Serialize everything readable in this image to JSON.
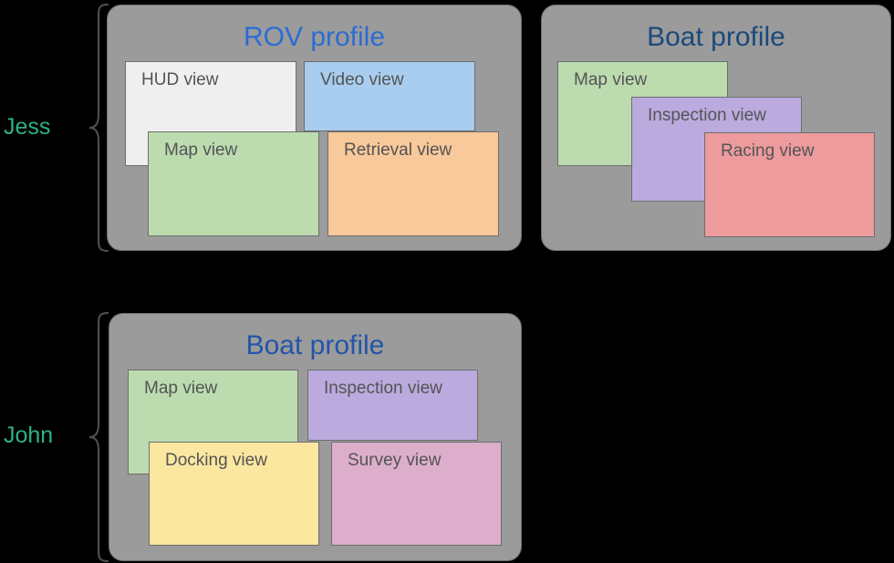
{
  "colors": {
    "background": "#000000",
    "panel_fill": "#9b9b9b",
    "panel_stroke": "#6e6e6e",
    "user_label": "#2eb086",
    "view_label_text": "#545454",
    "view_stroke": "#6e6e6e",
    "title_blue_bright": "#2b6cd4",
    "title_blue_medium": "#2255aa",
    "title_blue_dark": "#1a4a7a",
    "view_hud": "#efefef",
    "view_video": "#a8cdee",
    "view_map": "#bcdcb0",
    "view_retrieval": "#f8c99a",
    "view_inspection": "#bbaade",
    "view_racing": "#ed9b9d",
    "view_docking": "#fce7a0",
    "view_survey": "#ddaecb"
  },
  "users": [
    {
      "name": "Jess",
      "id": "jess"
    },
    {
      "name": "John",
      "id": "john"
    }
  ],
  "profiles": [
    {
      "id": "jess-rov",
      "title": "ROV profile",
      "title_color": "#2b6cd4",
      "owner": "Jess",
      "views": [
        {
          "label": "HUD view",
          "color": "#efefef"
        },
        {
          "label": "Video view",
          "color": "#a8cdee"
        },
        {
          "label": "Map view",
          "color": "#bcdcb0"
        },
        {
          "label": "Retrieval view",
          "color": "#f8c99a"
        }
      ]
    },
    {
      "id": "jess-boat",
      "title": "Boat profile",
      "title_color": "#1a4a7a",
      "owner": "Jess",
      "views": [
        {
          "label": "Map view",
          "color": "#bcdcb0"
        },
        {
          "label": "Inspection view",
          "color": "#bbaade"
        },
        {
          "label": "Racing view",
          "color": "#ed9b9d"
        }
      ]
    },
    {
      "id": "john-boat",
      "title": "Boat profile",
      "title_color": "#2255aa",
      "owner": "John",
      "views": [
        {
          "label": "Map view",
          "color": "#bcdcb0"
        },
        {
          "label": "Inspection view",
          "color": "#bbaade"
        },
        {
          "label": "Docking view",
          "color": "#fce7a0"
        },
        {
          "label": "Survey view",
          "color": "#ddaecb"
        }
      ]
    }
  ]
}
